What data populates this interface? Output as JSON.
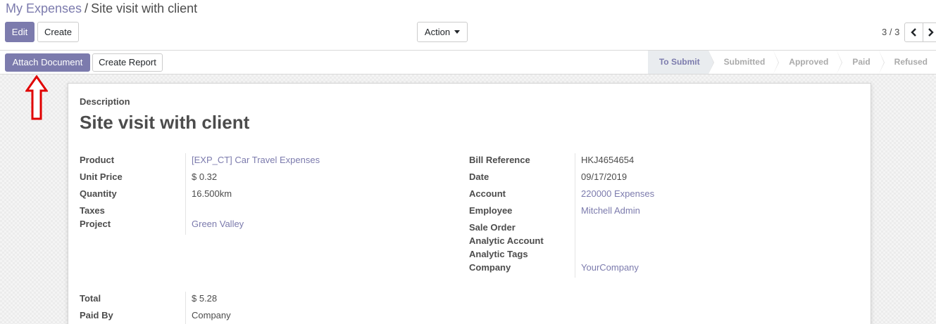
{
  "breadcrumb": {
    "parent": "My Expenses",
    "separator": "/",
    "current": "Site visit with client"
  },
  "toolbar": {
    "edit_label": "Edit",
    "create_label": "Create",
    "action_label": "Action"
  },
  "pager": {
    "value": "3 / 3",
    "prev_icon": "chevron-left-icon",
    "next_icon": "chevron-right-icon"
  },
  "statusbar": {
    "attach_label": "Attach Document",
    "report_label": "Create Report",
    "stages": [
      "To Submit",
      "Submitted",
      "Approved",
      "Paid",
      "Refused"
    ],
    "active_stage": "To Submit"
  },
  "form": {
    "description_label": "Description",
    "description_value": "Site visit with client",
    "left": [
      {
        "label": "Product",
        "value": "[EXP_CT] Car Travel Expenses",
        "link": true
      },
      {
        "label": "Unit Price",
        "value": "$ 0.32",
        "link": false
      },
      {
        "label": "Quantity",
        "value": "16.500km",
        "link": false
      },
      {
        "label": "Taxes",
        "value": "",
        "link": false
      },
      {
        "label": "Project",
        "value": "Green Valley",
        "link": true
      }
    ],
    "right": [
      {
        "label": "Bill Reference",
        "value": "HKJ4654654",
        "link": false
      },
      {
        "label": "Date",
        "value": "09/17/2019",
        "link": false
      },
      {
        "label": "Account",
        "value": "220000 Expenses",
        "link": true
      },
      {
        "label": "Employee",
        "value": "Mitchell Admin",
        "link": true
      },
      {
        "label": "Sale Order",
        "value": "",
        "link": false
      },
      {
        "label": "Analytic Account",
        "value": "",
        "link": false
      },
      {
        "label": "Analytic Tags",
        "value": "",
        "link": false
      },
      {
        "label": "Company",
        "value": "YourCompany",
        "link": true
      }
    ],
    "totals": [
      {
        "label": "Total",
        "value": "$ 5.28"
      },
      {
        "label": "Paid By",
        "value": "Company"
      }
    ]
  },
  "colors": {
    "accent": "#7c7bad",
    "annotation_arrow": "#e00000"
  }
}
